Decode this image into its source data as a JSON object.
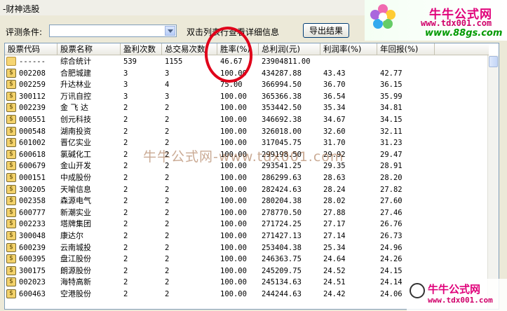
{
  "window": {
    "title": "-财神选股"
  },
  "toolbar": {
    "condition_label": "评测条件:",
    "condition_value": "",
    "hint": "双击列表行查看详细信息",
    "export_label": "导出结果"
  },
  "banner": {
    "brand": "牛牛公式网",
    "url1": "www.tdx001.com",
    "url2": "www.88gs.com"
  },
  "watermark": "牛牛公式网-www.tdx001.com",
  "logo_br": {
    "brand": "牛牛公式网",
    "url": "www.tdx001.com"
  },
  "columns": [
    "股票代码",
    "股票名称",
    "盈利次数",
    "总交易次数",
    "胜率(%)",
    "总利润(元)",
    "利润率(%)",
    "年回报(%)"
  ],
  "rows": [
    [
      "------",
      "综合统计",
      "539",
      "1155",
      "46.67",
      "23904811.00",
      "",
      ""
    ],
    [
      "002208",
      "合肥城建",
      "3",
      "3",
      "100.00",
      "434287.88",
      "43.43",
      "42.77"
    ],
    [
      "002259",
      "升达林业",
      "3",
      "4",
      "75.00",
      "366994.50",
      "36.70",
      "36.15"
    ],
    [
      "300112",
      "万讯自控",
      "3",
      "3",
      "100.00",
      "365366.38",
      "36.54",
      "35.99"
    ],
    [
      "002239",
      "金 飞 达",
      "2",
      "2",
      "100.00",
      "353442.50",
      "35.34",
      "34.81"
    ],
    [
      "000551",
      "创元科技",
      "2",
      "2",
      "100.00",
      "346692.38",
      "34.67",
      "34.15"
    ],
    [
      "000548",
      "湖南投资",
      "2",
      "2",
      "100.00",
      "326018.00",
      "32.60",
      "32.11"
    ],
    [
      "601002",
      "晋亿实业",
      "2",
      "2",
      "100.00",
      "317045.75",
      "31.70",
      "31.23"
    ],
    [
      "600618",
      "氯碱化工",
      "2",
      "2",
      "100.00",
      "299198.50",
      "29.92",
      "29.47"
    ],
    [
      "600679",
      "金山开发",
      "2",
      "2",
      "100.00",
      "293541.25",
      "29.35",
      "28.91"
    ],
    [
      "000151",
      "中成股份",
      "2",
      "2",
      "100.00",
      "286299.63",
      "28.63",
      "28.20"
    ],
    [
      "300205",
      "天喻信息",
      "2",
      "2",
      "100.00",
      "282424.63",
      "28.24",
      "27.82"
    ],
    [
      "002358",
      "森源电气",
      "2",
      "2",
      "100.00",
      "280204.38",
      "28.02",
      "27.60"
    ],
    [
      "600777",
      "新潮实业",
      "2",
      "2",
      "100.00",
      "278770.50",
      "27.88",
      "27.46"
    ],
    [
      "002233",
      "塔牌集团",
      "2",
      "2",
      "100.00",
      "271724.25",
      "27.17",
      "26.76"
    ],
    [
      "300048",
      "康达尔",
      "2",
      "2",
      "100.00",
      "271427.13",
      "27.14",
      "26.73"
    ],
    [
      "600239",
      "云南城投",
      "2",
      "2",
      "100.00",
      "253404.38",
      "25.34",
      "24.96"
    ],
    [
      "600395",
      "盘江股份",
      "2",
      "2",
      "100.00",
      "246363.75",
      "24.64",
      "24.26"
    ],
    [
      "300175",
      "朗源股份",
      "2",
      "2",
      "100.00",
      "245209.75",
      "24.52",
      "24.15"
    ],
    [
      "002023",
      "海特高新",
      "2",
      "2",
      "100.00",
      "245134.63",
      "24.51",
      "24.14"
    ],
    [
      "600463",
      "空港股份",
      "2",
      "2",
      "100.00",
      "244244.63",
      "24.42",
      "24.06"
    ]
  ]
}
